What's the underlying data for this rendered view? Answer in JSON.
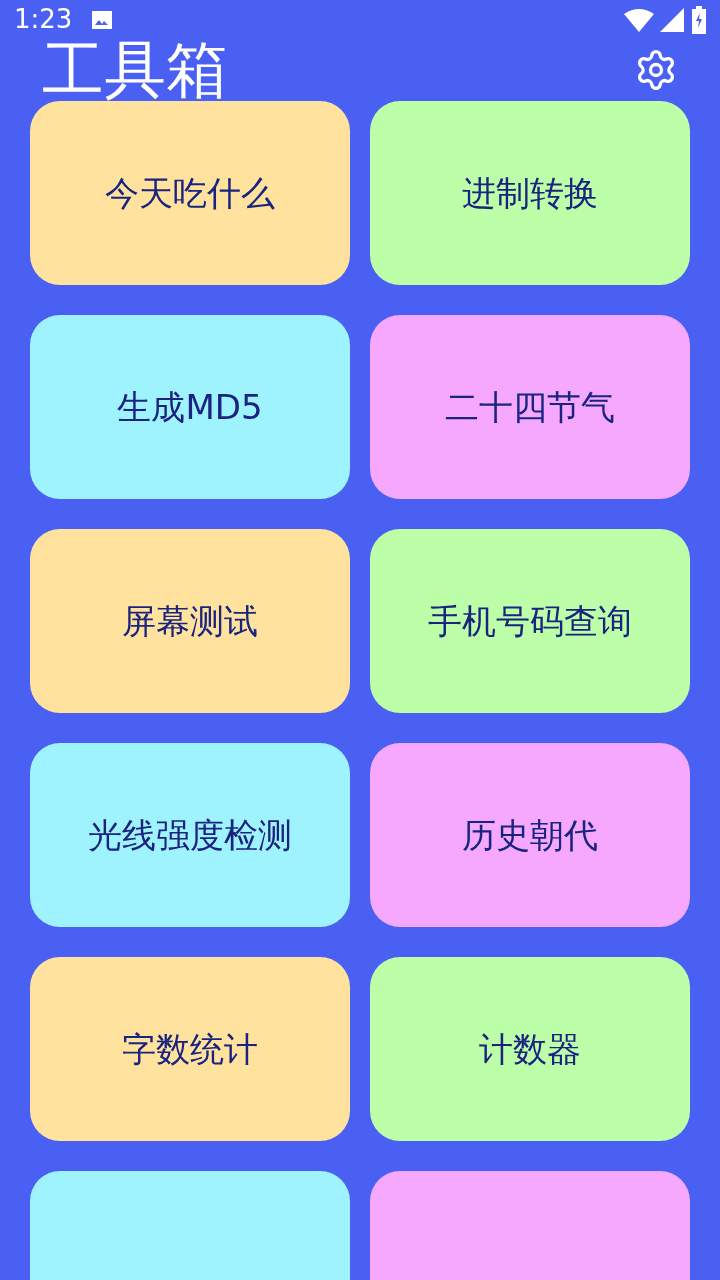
{
  "status_bar": {
    "time": "1:23"
  },
  "header": {
    "title": "工具箱"
  },
  "tiles": [
    {
      "label": "今天吃什么",
      "color": "#ffe29e"
    },
    {
      "label": "进制转换",
      "color": "#bdffa8"
    },
    {
      "label": "生成MD5",
      "color": "#9ef3ff"
    },
    {
      "label": "二十四节气",
      "color": "#f6a8ff"
    },
    {
      "label": "屏幕测试",
      "color": "#ffe29e"
    },
    {
      "label": "手机号码查询",
      "color": "#bdffa8"
    },
    {
      "label": "光线强度检测",
      "color": "#9ef3ff"
    },
    {
      "label": "历史朝代",
      "color": "#f6a8ff"
    },
    {
      "label": "字数统计",
      "color": "#ffe29e"
    },
    {
      "label": "计数器",
      "color": "#bdffa8"
    },
    {
      "color": "#9ef3ff"
    },
    {
      "color": "#f6a8ff"
    }
  ]
}
